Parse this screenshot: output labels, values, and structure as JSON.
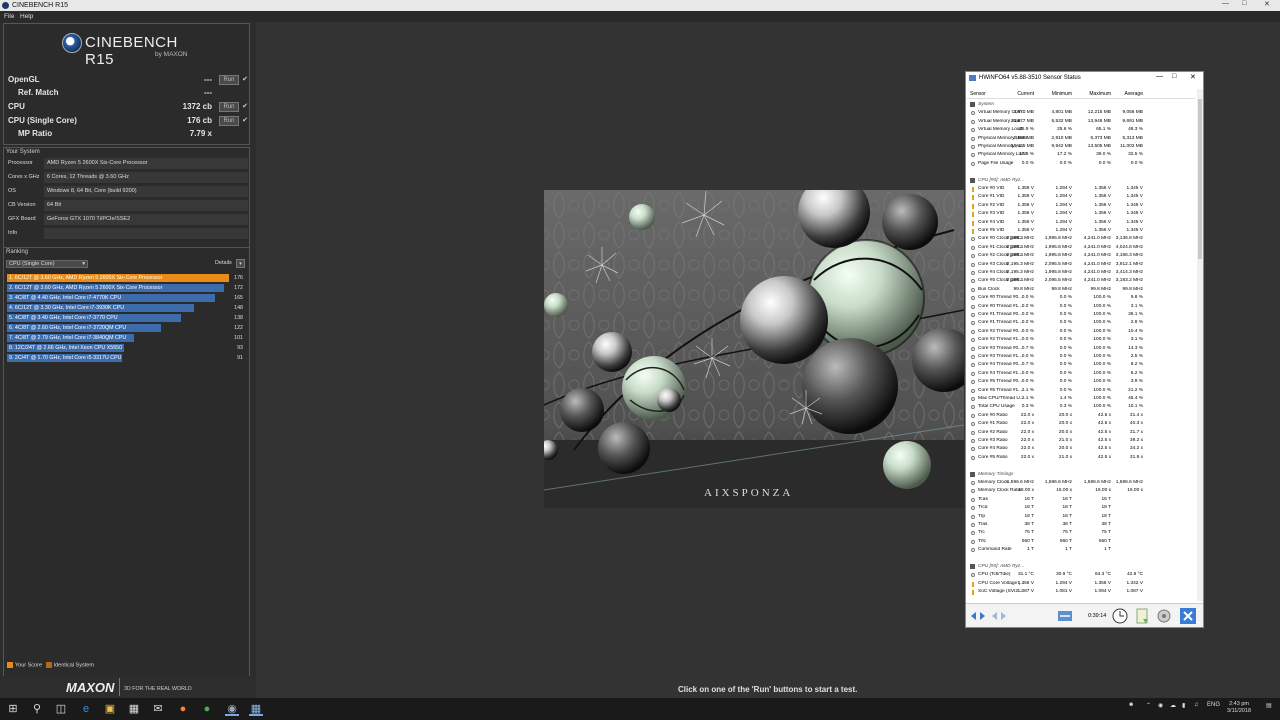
{
  "window": {
    "title": "CINEBENCH R15",
    "menu": [
      "File",
      "Help"
    ]
  },
  "logo": {
    "brand": "CINEBENCH R15",
    "by": "by MAXON"
  },
  "tests": [
    {
      "label": "OpenGL",
      "value": "---",
      "run": "Run",
      "check": "✔"
    },
    {
      "label": "Ref. Match",
      "value": "---"
    },
    {
      "label": "CPU",
      "value": "1372 cb",
      "run": "Run",
      "check": "✔"
    },
    {
      "label": "CPU (Single Core)",
      "value": "176 cb",
      "run": "Run",
      "check": "✔"
    },
    {
      "label": "MP Ratio",
      "value": "7.79 x"
    }
  ],
  "system": {
    "section": "Your System",
    "rows": [
      {
        "k": "Processor",
        "v": "AMD Ryzen 5 2600X Six-Core Processor"
      },
      {
        "k": "Cores x GHz",
        "v": "6 Cores, 12 Threads @ 3.60 GHz"
      },
      {
        "k": "OS",
        "v": "Windows 8, 64 Bit, Core (build 9200)"
      },
      {
        "k": "CB Version",
        "v": "64 Bit"
      },
      {
        "k": "GFX Board",
        "v": "GeForce GTX 1070 Ti/PCIe/SSE2"
      },
      {
        "k": "Info",
        "v": ""
      }
    ]
  },
  "ranking": {
    "section": "Ranking",
    "selected": "CPU (Single Core)",
    "details": "Details",
    "max_score": 176,
    "rows": [
      {
        "text": "1. 6C/12T @ 3.60 GHz, AMD Ryzen 5 2600X Six-Core Processor",
        "score": 176,
        "mine": true
      },
      {
        "text": "2. 6C/12T @ 3.60 GHz, AMD Ryzen 5 2600X Six-Core Processor",
        "score": 172,
        "mine": false
      },
      {
        "text": "3. 4C/8T @ 4.40 GHz, Intel Core i7-4770K CPU",
        "score": 165,
        "mine": false
      },
      {
        "text": "4. 6C/12T @ 3.30 GHz,  Intel Core i7-3930K CPU",
        "score": 148,
        "mine": false
      },
      {
        "text": "5. 4C/8T @ 3.40 GHz,  Intel Core i7-3770 CPU",
        "score": 138,
        "mine": false
      },
      {
        "text": "6. 4C/8T @ 2.60 GHz, Intel Core i7-3720QM CPU",
        "score": 122,
        "mine": false
      },
      {
        "text": "7. 4C/8T @ 2.79 GHz,  Intel Core i7-3840QM CPU",
        "score": 101,
        "mine": false
      },
      {
        "text": "8. 12C/24T @ 2.66 GHz, Intel Xeon CPU X5650",
        "score": 93,
        "mine": false
      },
      {
        "text": "9. 2C/4T @ 1.70 GHz,  Intel Core i5-3317U CPU",
        "score": 91,
        "mine": false
      }
    ]
  },
  "legend": {
    "your_score": "Your Score",
    "identical": "Identical System"
  },
  "footer": {
    "maxon": "MAXON",
    "tagline": "3D FOR THE REAL WORLD",
    "status": "Click on one of the 'Run' buttons to start a test."
  },
  "render": {
    "watermark": "AIXSPONZA"
  },
  "hwinfo": {
    "title": "HWiNFO64 v5.88-3510 Sensor Status",
    "columns": [
      "Sensor",
      "Current",
      "Minimum",
      "Maximum",
      "Average"
    ],
    "timer": "0:39:14",
    "rows": [
      {
        "g": "System"
      },
      {
        "n": "Virtual Memory Com...",
        "v": [
          "4,870 MB",
          "4,801 MB",
          "12,215 MB",
          "9,056 MB"
        ]
      },
      {
        "n": "Virtual Memory Avai...",
        "v": [
          "13,877 MB",
          "6,532 MB",
          "13,946 MB",
          "9,691 MB"
        ]
      },
      {
        "n": "Virtual Memory Load",
        "v": [
          "25.9 %",
          "25.6 %",
          "65.1 %",
          "48.3 %"
        ]
      },
      {
        "n": "Physical Memory Used",
        "v": [
          "2,880 MB",
          "2,810 MB",
          "6,373 MB",
          "5,313 MB"
        ]
      },
      {
        "n": "Physical Memory Av...",
        "v": [
          "13,435 MB",
          "9,942 MB",
          "13,505 MB",
          "11,002 MB"
        ]
      },
      {
        "n": "Physical Memory Load",
        "v": [
          "17.6 %",
          "17.2 %",
          "39.0 %",
          "32.5 %"
        ]
      },
      {
        "n": "Page File Usage",
        "v": [
          "0.0 %",
          "0.0 %",
          "0.0 %",
          "0.0 %"
        ]
      },
      {
        "sp": true
      },
      {
        "g": "CPU [#0]: AMD Ryz..."
      },
      {
        "n": "Core #0 VID",
        "v": [
          "1.356 V",
          "1.294 V",
          "1.356 V",
          "1.345 V"
        ],
        "volt": true
      },
      {
        "n": "Core #1 VID",
        "v": [
          "1.356 V",
          "1.294 V",
          "1.356 V",
          "1.345 V"
        ],
        "volt": true
      },
      {
        "n": "Core #2 VID",
        "v": [
          "1.356 V",
          "1.294 V",
          "1.356 V",
          "1.345 V"
        ],
        "volt": true
      },
      {
        "n": "Core #3 VID",
        "v": [
          "1.356 V",
          "1.294 V",
          "1.356 V",
          "1.345 V"
        ],
        "volt": true
      },
      {
        "n": "Core #4 VID",
        "v": [
          "1.356 V",
          "1.294 V",
          "1.356 V",
          "1.345 V"
        ],
        "volt": true
      },
      {
        "n": "Core #5 VID",
        "v": [
          "1.356 V",
          "1.294 V",
          "1.356 V",
          "1.345 V"
        ],
        "volt": true
      },
      {
        "n": "Core #0 Clock (perf...",
        "v": [
          "2,195.3 MHz",
          "1,995.8 MHz",
          "4,241.0 MHz",
          "3,136.8 MHz"
        ]
      },
      {
        "n": "Core #1 Clock (perf...",
        "v": [
          "2,195.3 MHz",
          "1,995.8 MHz",
          "4,241.0 MHz",
          "4,024.8 MHz"
        ]
      },
      {
        "n": "Core #2 Clock (perf...",
        "v": [
          "2,195.3 MHz",
          "1,995.8 MHz",
          "4,241.0 MHz",
          "3,166.3 MHz"
        ]
      },
      {
        "n": "Core #3 Clock",
        "v": [
          "2,195.3 MHz",
          "2,095.5 MHz",
          "4,241.0 MHz",
          "3,912.1 MHz"
        ]
      },
      {
        "n": "Core #4 Clock",
        "v": [
          "2,195.3 MHz",
          "1,995.8 MHz",
          "4,241.0 MHz",
          "3,414.3 MHz"
        ]
      },
      {
        "n": "Core #5 Clock (perf...",
        "v": [
          "2,195.3 MHz",
          "2,095.5 MHz",
          "4,241.0 MHz",
          "3,183.2 MHz"
        ]
      },
      {
        "n": "Bus Clock",
        "v": [
          "99.8 MHz",
          "99.8 MHz",
          "99.8 MHz",
          "99.8 MHz"
        ]
      },
      {
        "n": "Core #0 Thread #0...",
        "v": [
          "0.0 %",
          "0.0 %",
          "100.0 %",
          "9.8 %"
        ]
      },
      {
        "n": "Core #0 Thread #1...",
        "v": [
          "0.0 %",
          "0.0 %",
          "100.0 %",
          "3.1 %"
        ]
      },
      {
        "n": "Core #1 Thread #0...",
        "v": [
          "0.0 %",
          "0.0 %",
          "100.0 %",
          "36.1 %"
        ]
      },
      {
        "n": "Core #1 Thread #1...",
        "v": [
          "0.0 %",
          "0.0 %",
          "100.0 %",
          "2.8 %"
        ]
      },
      {
        "n": "Core #2 Thread #0...",
        "v": [
          "0.0 %",
          "0.0 %",
          "100.0 %",
          "10.4 %"
        ]
      },
      {
        "n": "Core #2 Thread #1...",
        "v": [
          "0.0 %",
          "0.0 %",
          "100.0 %",
          "3.1 %"
        ]
      },
      {
        "n": "Core #3 Thread #0...",
        "v": [
          "0.7 %",
          "0.0 %",
          "100.0 %",
          "14.3 %"
        ]
      },
      {
        "n": "Core #3 Thread #1...",
        "v": [
          "0.0 %",
          "0.0 %",
          "100.0 %",
          "2.5 %"
        ]
      },
      {
        "n": "Core #4 Thread #0...",
        "v": [
          "0.7 %",
          "0.0 %",
          "100.0 %",
          "8.2 %"
        ]
      },
      {
        "n": "Core #4 Thread #1...",
        "v": [
          "0.0 %",
          "0.0 %",
          "100.0 %",
          "6.2 %"
        ]
      },
      {
        "n": "Core #5 Thread #0...",
        "v": [
          "0.0 %",
          "0.0 %",
          "100.0 %",
          "3.9 %"
        ]
      },
      {
        "n": "Core #5 Thread #1...",
        "v": [
          "2.1 %",
          "0.0 %",
          "100.0 %",
          "21.2 %"
        ]
      },
      {
        "n": "Max CPU/Thread U...",
        "v": [
          "2.1 %",
          "1.4 %",
          "100.0 %",
          "45.4 %"
        ]
      },
      {
        "n": "Total CPU Usage",
        "v": [
          "0.3 %",
          "0.3 %",
          "100.0 %",
          "10.1 %"
        ]
      },
      {
        "n": "Core #0 Ratio",
        "v": [
          "22.0 x",
          "20.0 x",
          "42.5 x",
          "31.4 x"
        ]
      },
      {
        "n": "Core #1 Ratio",
        "v": [
          "22.0 x",
          "20.0 x",
          "42.5 x",
          "40.3 x"
        ]
      },
      {
        "n": "Core #2 Ratio",
        "v": [
          "22.0 x",
          "20.0 x",
          "42.5 x",
          "31.7 x"
        ]
      },
      {
        "n": "Core #3 Ratio",
        "v": [
          "22.0 x",
          "21.0 x",
          "42.5 x",
          "39.2 x"
        ]
      },
      {
        "n": "Core #4 Ratio",
        "v": [
          "22.0 x",
          "20.0 x",
          "42.5 x",
          "34.2 x"
        ]
      },
      {
        "n": "Core #5 Ratio",
        "v": [
          "22.0 x",
          "21.0 x",
          "42.5 x",
          "31.9 x"
        ]
      },
      {
        "sp": true
      },
      {
        "g": "Memory Timings"
      },
      {
        "n": "Memory Clock",
        "v": [
          "1,596.6 MHz",
          "1,596.6 MHz",
          "1,596.6 MHz",
          "1,596.6 MHz"
        ]
      },
      {
        "n": "Memory Clock Ratio",
        "v": [
          "16.00 x",
          "16.00 x",
          "16.00 x",
          "16.00 x"
        ]
      },
      {
        "n": "Tcas",
        "v": [
          "16 T",
          "16 T",
          "16 T",
          ""
        ]
      },
      {
        "n": "Trcd",
        "v": [
          "18 T",
          "18 T",
          "18 T",
          ""
        ]
      },
      {
        "n": "Trp",
        "v": [
          "18 T",
          "18 T",
          "18 T",
          ""
        ]
      },
      {
        "n": "Tras",
        "v": [
          "38 T",
          "38 T",
          "38 T",
          ""
        ]
      },
      {
        "n": "Trc",
        "v": [
          "75 T",
          "75 T",
          "75 T",
          ""
        ]
      },
      {
        "n": "Trfc",
        "v": [
          "560 T",
          "560 T",
          "560 T",
          ""
        ]
      },
      {
        "n": "Command Rate",
        "v": [
          "1 T",
          "1 T",
          "1 T",
          ""
        ]
      },
      {
        "sp": true
      },
      {
        "g": "CPU [#0]: AMD Ryz..."
      },
      {
        "n": "CPU (Tctl/Tdie)",
        "v": [
          "31.1 °C",
          "30.9 °C",
          "64.3 °C",
          "42.8 °C"
        ]
      },
      {
        "n": "CPU Core Voltage (...",
        "v": [
          "1.356 V",
          "1.294 V",
          "1.356 V",
          "1.342 V"
        ],
        "volt": true
      },
      {
        "n": "SoC Voltage (SVI2 ...",
        "v": [
          "1.087 V",
          "1.081 V",
          "1.094 V",
          "1.087 V"
        ],
        "volt": true
      }
    ]
  },
  "taskbar": {
    "lang": "ENG",
    "time": "2:43 pm",
    "date": "3/11/2018"
  },
  "colors": {
    "accent": "#e88b18",
    "bar": "#3d6cad"
  }
}
